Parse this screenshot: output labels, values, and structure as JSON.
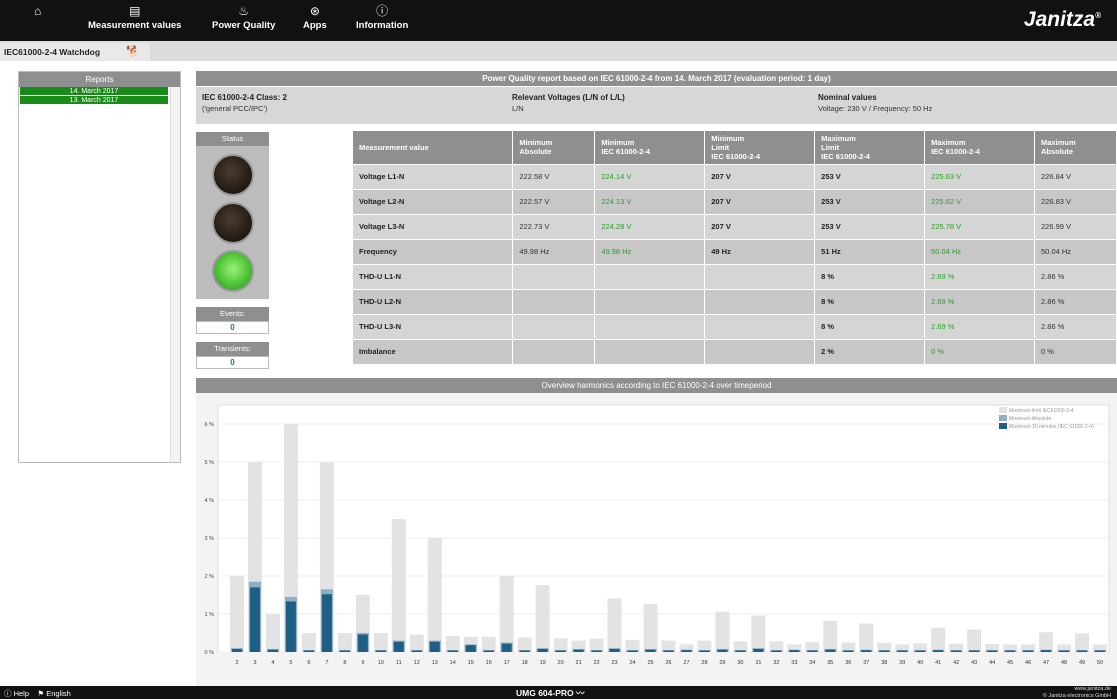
{
  "nav": {
    "items": [
      {
        "label": "",
        "icon": "home-icon",
        "glyph": "⌂"
      },
      {
        "label": "Measurement values",
        "icon": "meter-icon",
        "glyph": "▤"
      },
      {
        "label": "Power Quality",
        "icon": "power-quality-icon",
        "glyph": "♨"
      },
      {
        "label": "Apps",
        "icon": "apps-icon",
        "glyph": "⊛"
      },
      {
        "label": "Information",
        "icon": "info-icon",
        "glyph": "ⓘ"
      }
    ],
    "brand": "Janitza",
    "brand_mark": "®"
  },
  "tab": {
    "label": "IEC61000-2-4 Watchdog",
    "icon": "watchdog-icon",
    "glyph": "🐕"
  },
  "reports": {
    "title": "Reports",
    "items": [
      "14. March 2017",
      "13. March 2017"
    ]
  },
  "report": {
    "title": "Power Quality report based on IEC 61000-2-4 from 14. March 2017 (evaluation period: 1 day)",
    "class_title": "IEC 61000-2-4 Class: 2",
    "class_sub": "('general PCC/IPC')",
    "voltages_title": "Relevant Voltages (L/N of L/L)",
    "voltages_sub": "L/N",
    "nominal_title": "Nominal values",
    "nominal_sub": "Voltage: 230 V / Frequency: 50 Hz"
  },
  "status": {
    "title": "Status",
    "lamps": [
      "off",
      "off",
      "green"
    ],
    "events_label": "Events:",
    "events_value": "0",
    "transients_label": "Transients:",
    "transients_value": "0"
  },
  "table": {
    "headers": [
      "Measurement value",
      "Minimum\nAbsolute",
      "Minimum\nIEC 61000-2-4",
      "Minimum\nLimit\nIEC 61000-2-4",
      "Maximum\nLimit\nIEC 61000-2-4",
      "Maximum\nIEC 61000-2-4",
      "Maximum\nAbsolute"
    ],
    "rows": [
      [
        "Voltage L1-N",
        "222.58 V",
        "224.14 V",
        "207 V",
        "253 V",
        "225.63 V",
        "226.84 V"
      ],
      [
        "Voltage L2-N",
        "222.57 V",
        "224.13 V",
        "207 V",
        "253 V",
        "225.62 V",
        "226.83 V"
      ],
      [
        "Voltage L3-N",
        "222.73 V",
        "224.28 V",
        "207 V",
        "253 V",
        "225.78 V",
        "226.99 V"
      ],
      [
        "Frequency",
        "49.98 Hz",
        "49.98 Hz",
        "49 Hz",
        "51 Hz",
        "50.04 Hz",
        "50.04 Hz"
      ],
      [
        "THD-U L1-N",
        "",
        "",
        "",
        "8 %",
        "2.69 %",
        "2.86 %"
      ],
      [
        "THD-U L2-N",
        "",
        "",
        "",
        "8 %",
        "2.69 %",
        "2.86 %"
      ],
      [
        "THD-U L3-N",
        "",
        "",
        "",
        "8 %",
        "2.69 %",
        "2.86 %"
      ],
      [
        "Imbalance",
        "",
        "",
        "",
        "2 %",
        "0 %",
        "0 %"
      ]
    ]
  },
  "harmonics_title": "Overview harmonics according to IEC 61000-2-4 over timeperiod",
  "chart_data": {
    "type": "bar",
    "categories": [
      "2",
      "3",
      "4",
      "5",
      "6",
      "7",
      "8",
      "9",
      "10",
      "11",
      "12",
      "13",
      "14",
      "15",
      "16",
      "17",
      "18",
      "19",
      "20",
      "21",
      "22",
      "23",
      "24",
      "25",
      "26",
      "27",
      "28",
      "29",
      "30",
      "31",
      "32",
      "33",
      "34",
      "35",
      "36",
      "37",
      "38",
      "39",
      "40",
      "41",
      "42",
      "43",
      "44",
      "45",
      "46",
      "47",
      "48",
      "49",
      "50"
    ],
    "yticks": [
      "0 %",
      "1 %",
      "2 %",
      "3 %",
      "4 %",
      "5 %",
      "6 %"
    ],
    "ylim": [
      0,
      6.5
    ],
    "series": [
      {
        "name": "Maximum limit IEC61000-2-4",
        "color": "#e3e3e3",
        "values": [
          2,
          5,
          1,
          6,
          0.5,
          5,
          0.5,
          1.5,
          0.5,
          3.5,
          0.46,
          3,
          0.42,
          0.4,
          0.4,
          2,
          0.38,
          1.76,
          0.36,
          0.3,
          0.35,
          1.41,
          0.32,
          1.26,
          0.3,
          0.2,
          0.3,
          1.06,
          0.28,
          0.96,
          0.28,
          0.2,
          0.26,
          0.82,
          0.25,
          0.75,
          0.24,
          0.2,
          0.23,
          0.64,
          0.22,
          0.59,
          0.21,
          0.2,
          0.2,
          0.52,
          0.2,
          0.49,
          0.2
        ]
      },
      {
        "name": "Maximum Absolute",
        "color": "#8fb0c4",
        "values": [
          0.1,
          1.85,
          0.08,
          1.45,
          0.05,
          1.65,
          0.05,
          0.5,
          0.05,
          0.3,
          0.05,
          0.3,
          0.05,
          0.2,
          0.05,
          0.25,
          0.05,
          0.1,
          0.05,
          0.08,
          0.05,
          0.1,
          0.05,
          0.08,
          0.05,
          0.06,
          0.05,
          0.08,
          0.05,
          0.1,
          0.05,
          0.06,
          0.05,
          0.08,
          0.05,
          0.06,
          0.05,
          0.05,
          0.05,
          0.06,
          0.05,
          0.05,
          0.05,
          0.05,
          0.05,
          0.06,
          0.05,
          0.05,
          0.05
        ]
      },
      {
        "name": "Maximum 10 minutes (IEC 61000-2-4)",
        "color": "#1e5f86",
        "values": [
          0.08,
          1.7,
          0.06,
          1.33,
          0.04,
          1.52,
          0.04,
          0.46,
          0.04,
          0.27,
          0.04,
          0.27,
          0.04,
          0.18,
          0.04,
          0.22,
          0.04,
          0.08,
          0.04,
          0.06,
          0.04,
          0.08,
          0.04,
          0.06,
          0.04,
          0.05,
          0.04,
          0.06,
          0.04,
          0.08,
          0.04,
          0.05,
          0.04,
          0.06,
          0.04,
          0.05,
          0.04,
          0.04,
          0.04,
          0.05,
          0.04,
          0.04,
          0.04,
          0.04,
          0.04,
          0.05,
          0.04,
          0.04,
          0.04
        ]
      }
    ],
    "legend_placement": "top-right",
    "grid": true
  },
  "footer": {
    "help": "Help",
    "help_glyph": "ⓘ",
    "language": "English",
    "language_glyph": "⚑",
    "device": "UMG 604-PRO",
    "copyright_url": "www.janitza.de",
    "copyright": "© Janitza electronics GmbH"
  }
}
